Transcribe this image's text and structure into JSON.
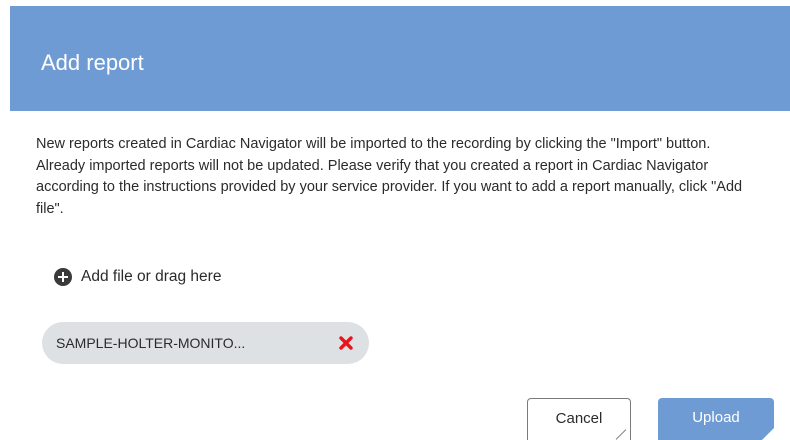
{
  "dialog": {
    "title": "Add report",
    "message": "New reports created in Cardiac Navigator will be imported to the recording by clicking the \"Import\" button. Already imported reports will not be updated. Please verify that you created a report in Cardiac Navigator according to the instructions provided by your service provider. If you want to add a report manually, click \"Add file\".",
    "add_file_label": "Add file or drag here",
    "add_file_icon": "plus-circle-icon",
    "files": [
      {
        "name": "SAMPLE-HOLTER-MONITO...",
        "remove_icon": "remove-cross-icon"
      }
    ],
    "buttons": {
      "cancel_label": "Cancel",
      "upload_label": "Upload"
    }
  },
  "colors": {
    "header_bg": "#6f9bd4",
    "upload_bg": "#6f9bd4",
    "chip_bg": "#dde1e4",
    "remove_icon": "#e8141b",
    "text": "#2b2b2b"
  }
}
